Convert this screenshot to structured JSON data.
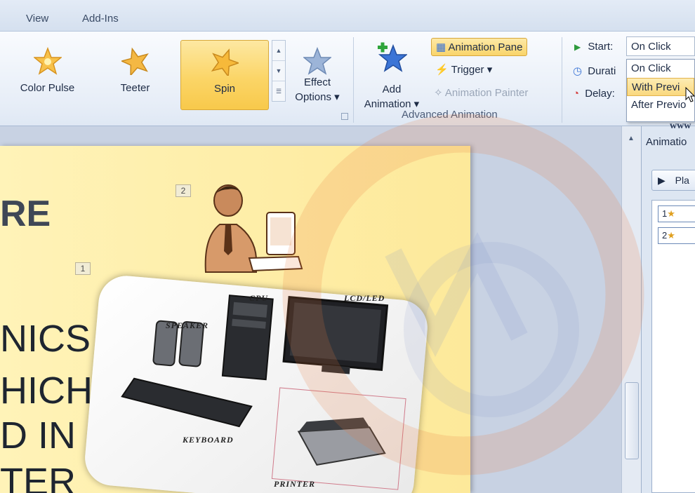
{
  "ribbon_tabs": [
    "View",
    "Add-Ins"
  ],
  "animation_gallery": [
    {
      "label": "Color Pulse",
      "icon": "star-color-pulse-icon"
    },
    {
      "label": "Teeter",
      "icon": "star-teeter-icon"
    },
    {
      "label": "Spin",
      "icon": "star-spin-icon",
      "selected": true
    }
  ],
  "effect_options": {
    "line1": "Effect",
    "line2": "Options ▾"
  },
  "add_animation": {
    "line1": "Add",
    "line2": "Animation ▾"
  },
  "advanced": {
    "animation_pane": "Animation Pane",
    "trigger": "Trigger ▾",
    "animation_painter": "Animation Painter",
    "group_label": "Advanced Animation"
  },
  "timing": {
    "start_label": "Start:",
    "start_value": "On Click",
    "duration_label": "Durati",
    "delay_label": "Delay:",
    "options": [
      "On Click",
      "With Previ",
      "After Previo"
    ],
    "hovered_option": "With Previ"
  },
  "slide": {
    "title_fragment": "RE",
    "text_lines": [
      "NICS",
      "HICH",
      "D IN",
      "TER"
    ],
    "tags": [
      "2",
      "1"
    ],
    "hardware_labels": [
      "CPU",
      "LCD/LED",
      "SPEAKER",
      "KEYBOARD",
      "PRINTER"
    ]
  },
  "pane": {
    "title": "Animatio",
    "play_label": "Pla",
    "items": [
      "1",
      "2"
    ]
  },
  "watermark_text": "www",
  "colors": {
    "selection": "#fbd567",
    "ribbon": "#e6edf7",
    "slide": "#fde99a"
  }
}
